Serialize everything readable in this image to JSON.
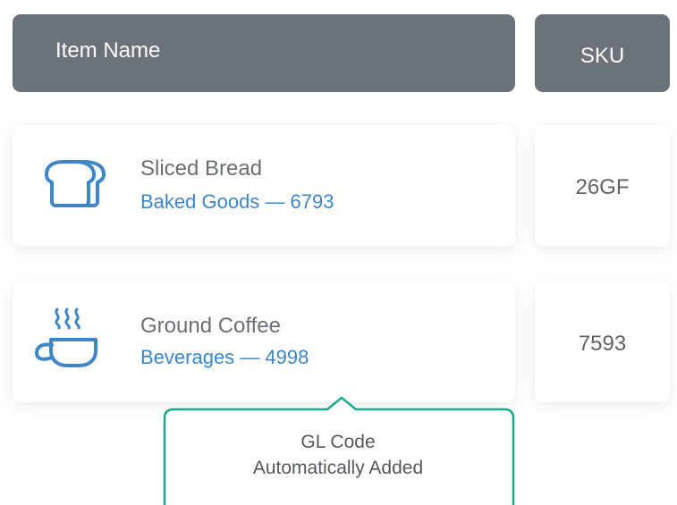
{
  "header": {
    "item_name_label": "Item Name",
    "sku_label": "SKU"
  },
  "items": [
    {
      "icon": "bread-icon",
      "name": "Sliced Bread",
      "gl_category": "Baked Goods — 6793",
      "sku": "26GF"
    },
    {
      "icon": "coffee-cup-icon",
      "name": "Ground Coffee",
      "gl_category": "Beverages — 4998",
      "sku": "7593"
    }
  ],
  "callout": {
    "line1": "GL Code",
    "line2": "Automatically Added"
  },
  "colors": {
    "header_bg": "#6b727a",
    "accent_blue": "#3f86c4",
    "callout_border": "#1aaa8a"
  }
}
